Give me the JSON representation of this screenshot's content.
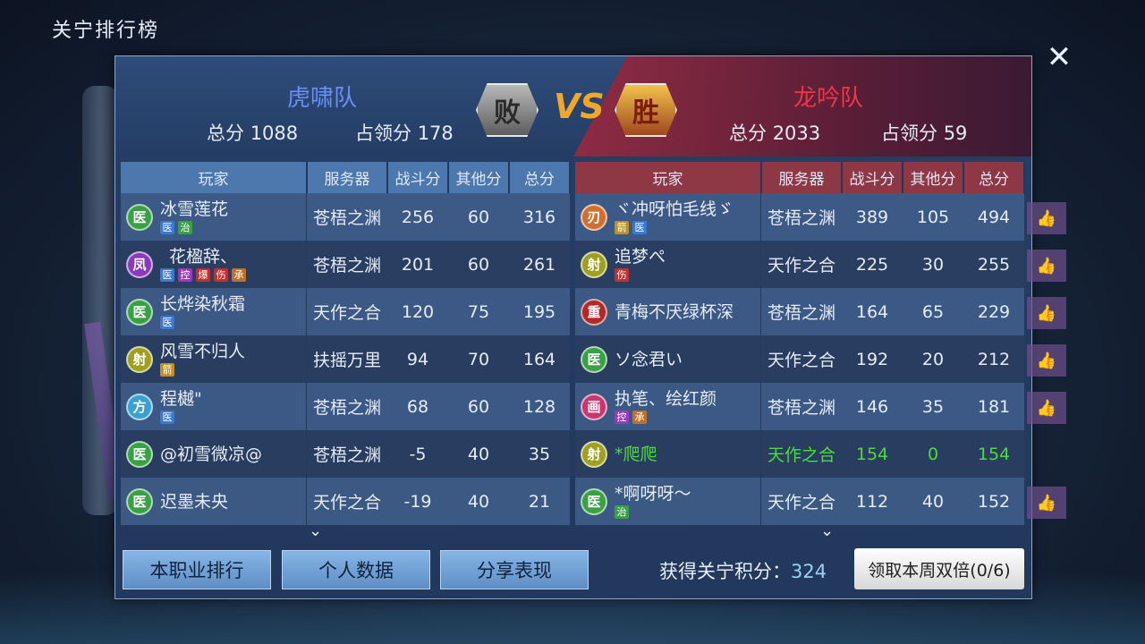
{
  "page_title": "关宁排行榜",
  "close_icon": "close-icon",
  "left_team": {
    "name": "虎啸队",
    "total_label": "总分",
    "total": "1088",
    "occupy_label": "占领分",
    "occupy": "178",
    "color": "#6a8ff5"
  },
  "right_team": {
    "name": "龙吟队",
    "total_label": "总分",
    "total": "2033",
    "occupy_label": "占领分",
    "occupy": "59",
    "color": "#f0344a"
  },
  "result": {
    "left": "败",
    "vs": "VS",
    "right": "胜"
  },
  "columns": [
    "玩家",
    "服务器",
    "战斗分",
    "其他分",
    "总分"
  ],
  "left_rows": [
    {
      "cls": "医",
      "cls_color": "#3aa045",
      "name": "冰雪莲花",
      "tags": [
        {
          "t": "医",
          "c": "#3a7ad0"
        },
        {
          "t": "治",
          "c": "#3aa045"
        }
      ],
      "server": "苍梧之渊",
      "battle": "256",
      "other": "60",
      "total": "316"
    },
    {
      "cls": "凤",
      "cls_color": "#8a3ab8",
      "name": "花楹辞、",
      "tags": [
        {
          "t": "医",
          "c": "#3a7ad0"
        },
        {
          "t": "控",
          "c": "#9a3ab8"
        },
        {
          "t": "爆",
          "c": "#c03030"
        },
        {
          "t": "伤",
          "c": "#c03030"
        },
        {
          "t": "承",
          "c": "#c07028"
        }
      ],
      "server": "苍梧之渊",
      "battle": "201",
      "other": "60",
      "total": "261"
    },
    {
      "cls": "医",
      "cls_color": "#3aa045",
      "name": "长烨染秋霜",
      "tags": [
        {
          "t": "医",
          "c": "#3a7ad0"
        }
      ],
      "server": "天作之合",
      "battle": "120",
      "other": "75",
      "total": "195"
    },
    {
      "cls": "射",
      "cls_color": "#a0a020",
      "name": "风雪不归人",
      "tags": [
        {
          "t": "箭",
          "c": "#c09020"
        }
      ],
      "server": "扶摇万里",
      "battle": "94",
      "other": "70",
      "total": "164"
    },
    {
      "cls": "方",
      "cls_color": "#3aa0d0",
      "name": "程樾\"",
      "tags": [
        {
          "t": "医",
          "c": "#3a7ad0"
        }
      ],
      "server": "苍梧之渊",
      "battle": "68",
      "other": "60",
      "total": "128"
    },
    {
      "cls": "医",
      "cls_color": "#3aa045",
      "name": "@初雪微凉@",
      "tags": [],
      "server": "苍梧之渊",
      "battle": "-5",
      "other": "40",
      "total": "35"
    },
    {
      "cls": "医",
      "cls_color": "#3aa045",
      "name": "迟墨未央",
      "tags": [],
      "server": "天作之合",
      "battle": "-19",
      "other": "40",
      "total": "21"
    }
  ],
  "right_rows": [
    {
      "cls": "刃",
      "cls_color": "#d07030",
      "name": "ヾ冲呀怕毛线ゞ",
      "tags": [
        {
          "t": "箭",
          "c": "#c09020"
        },
        {
          "t": "医",
          "c": "#3a7ad0"
        }
      ],
      "server": "苍梧之渊",
      "battle": "389",
      "other": "105",
      "total": "494",
      "hl": false
    },
    {
      "cls": "射",
      "cls_color": "#a0a020",
      "name": "追梦ぺ",
      "tags": [
        {
          "t": "伤",
          "c": "#c03030"
        }
      ],
      "server": "天作之合",
      "battle": "225",
      "other": "30",
      "total": "255",
      "hl": false
    },
    {
      "cls": "重",
      "cls_color": "#b02828",
      "name": "青梅不厌绿杯深",
      "tags": [],
      "server": "苍梧之渊",
      "battle": "164",
      "other": "65",
      "total": "229",
      "hl": false
    },
    {
      "cls": "医",
      "cls_color": "#3aa045",
      "name": "ソ念君い",
      "tags": [],
      "server": "天作之合",
      "battle": "192",
      "other": "20",
      "total": "212",
      "hl": false
    },
    {
      "cls": "画",
      "cls_color": "#c83870",
      "name": "执笔、绘红颜",
      "tags": [
        {
          "t": "控",
          "c": "#9a3ab8"
        },
        {
          "t": "承",
          "c": "#c07028"
        }
      ],
      "server": "苍梧之渊",
      "battle": "146",
      "other": "35",
      "total": "181",
      "hl": false
    },
    {
      "cls": "射",
      "cls_color": "#a0a020",
      "name": "*爬爬",
      "tags": [],
      "server": "天作之合",
      "battle": "154",
      "other": "0",
      "total": "154",
      "hl": true
    },
    {
      "cls": "医",
      "cls_color": "#3aa045",
      "name": "*啊呀呀～",
      "tags": [
        {
          "t": "治",
          "c": "#3aa045"
        }
      ],
      "server": "天作之合",
      "battle": "112",
      "other": "40",
      "total": "152",
      "hl": false
    }
  ],
  "like_icon": "thumbs-up-icon",
  "buttons": {
    "class_rank": "本职业排行",
    "personal": "个人数据",
    "share": "分享表现",
    "double": "领取本周双倍(0/6)"
  },
  "points": {
    "label": "获得关宁积分：",
    "value": "324"
  }
}
